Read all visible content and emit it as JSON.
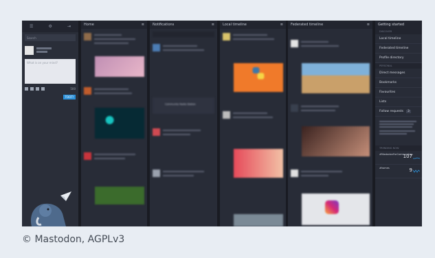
{
  "caption": "© Mastodon, AGPLv3",
  "compose": {
    "search_placeholder": "Search",
    "editor_placeholder": "What is on your mind?",
    "toot_label": "TOOT!",
    "char_count": "500"
  },
  "columns": {
    "home": "Home",
    "notifications": "Notifications",
    "local": "Local timeline",
    "federated": "Federated timeline"
  },
  "sidebar": {
    "title": "Getting started",
    "discover_label": "DISCOVER",
    "personal_label": "PERSONAL",
    "items_discover": [
      "Local timeline",
      "Federated timeline",
      "Profile directory"
    ],
    "items_personal": [
      "Direct messages",
      "Bookmarks",
      "Favourites",
      "Lists",
      "Follow requests"
    ],
    "follow_requests_count": "3",
    "trending_label": "TRENDING NOW",
    "trends": [
      {
        "name": "#MastodonForCommunities",
        "count": "107"
      },
      {
        "name": "#homes",
        "count": "9"
      }
    ]
  },
  "notification_card": "Community Radio Station"
}
